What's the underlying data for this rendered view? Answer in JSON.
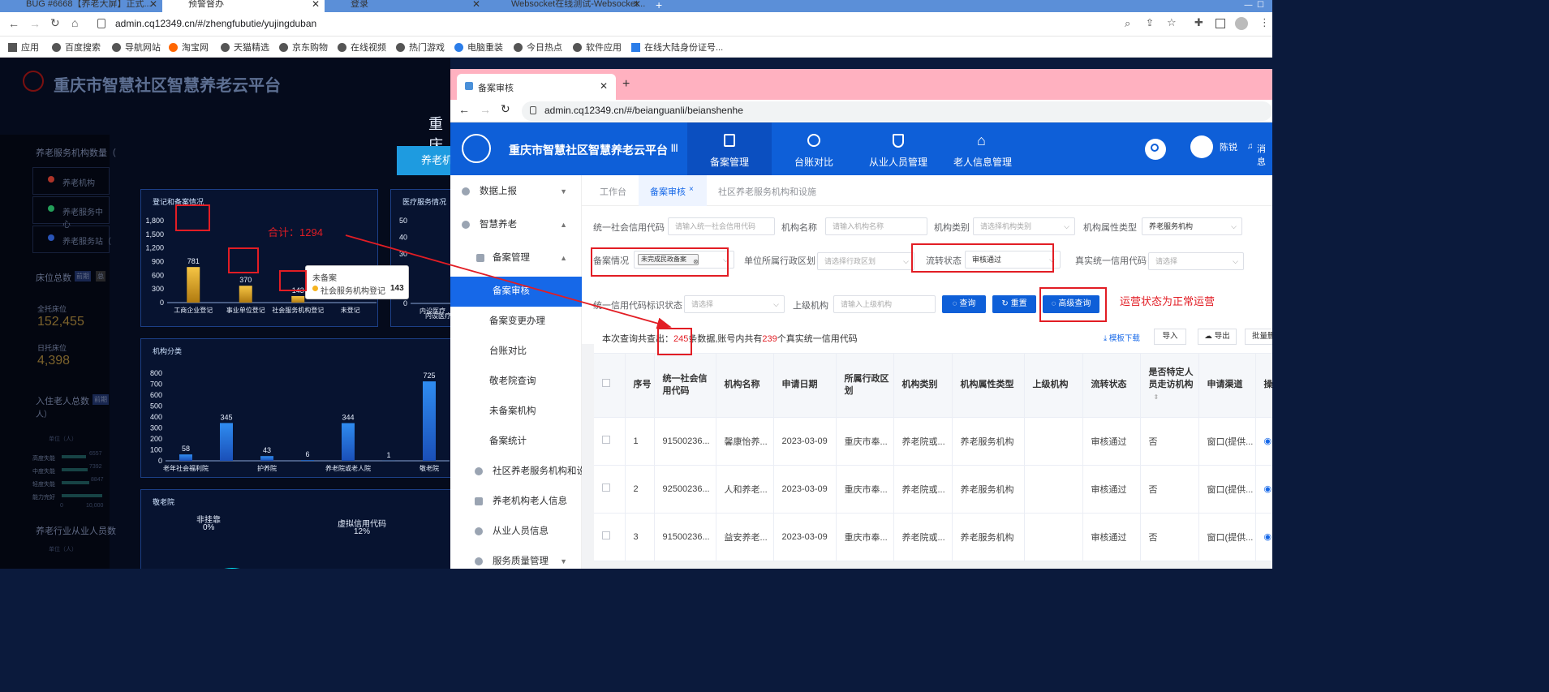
{
  "browser": {
    "tabs": [
      "BUG #6668【养老大屏】正式...",
      "预警督办",
      "登录",
      "Websocket在线测试-Websocket..."
    ],
    "url": "admin.cq12349.cn/#/zhengfubutie/yujingduban",
    "new_tab": "+",
    "bookmarks": [
      "应用",
      "百度搜索",
      "导航网站",
      "淘宝网",
      "天猫精选",
      "京东购物",
      "在线视频",
      "热门游戏",
      "电脑重装",
      "今日热点",
      "软件应用",
      "在线大陆身份证号..."
    ]
  },
  "dashboard": {
    "title": "重庆市智慧社区智慧养老云平台",
    "center_title": "重庆",
    "center_button": "养老机",
    "left_stats": {
      "heading": "养老服务机构数量（",
      "items": [
        "养老机构",
        "养老服务中心",
        "养老服务站（"
      ],
      "bed_heading": "床位总数",
      "bed_tags": [
        "前期",
        "总"
      ],
      "total_beds_label": "全托床位",
      "total_beds": "152,455",
      "daycare_label": "日托床位",
      "daycare_beds": "4,398",
      "residents_heading": "入住老人总数",
      "residents_tag": "前期",
      "residents_unit": "人）",
      "unit_label": "单位（人）",
      "care_levels": [
        "高度失能",
        "中度失能",
        "轻度失能",
        "能力完好"
      ],
      "care_values": [
        "6557",
        "7392",
        "8847",
        ""
      ],
      "axis": [
        "0",
        "10,000"
      ],
      "staff_heading": "养老行业从业人员数",
      "staff_unit": "单位（人）"
    },
    "chart1": {
      "title": "登记和备案情况",
      "annotation": "合计：1294",
      "tooltip_title": "未备案",
      "tooltip_label": "社会服务机构登记",
      "tooltip_value": "143"
    },
    "chart2_title": "医疗服务情况",
    "chart2_note": "内设医疗",
    "chart3_title": "机构分类",
    "chart4": {
      "title": "敬老院",
      "labels": [
        "非挂靠",
        "虚拟信用代码"
      ],
      "values": [
        "0%",
        "12%"
      ]
    }
  },
  "chart_data": [
    {
      "type": "bar",
      "title": "登记和备案情况",
      "categories": [
        "工商企业登记",
        "事业单位登记",
        "社会服务机构登记",
        "未登记"
      ],
      "values": [
        781,
        370,
        143,
        0
      ],
      "ylim": [
        0,
        1800
      ],
      "yticks": [
        "0",
        "300",
        "600",
        "900",
        "1,200",
        "1,500",
        "1,800"
      ]
    },
    {
      "type": "bar",
      "title": "医疗服务情况",
      "ylim": [
        0,
        50
      ],
      "yticks": [
        "0",
        "10",
        "30",
        "40",
        "50"
      ],
      "categories": [
        "内设医疗"
      ]
    },
    {
      "type": "bar",
      "title": "机构分类",
      "categories": [
        "老年社会福利院",
        "",
        "护养院",
        "",
        "养老院或老人院",
        "",
        "敬老院"
      ],
      "values": [
        58,
        345,
        43,
        6,
        344,
        1,
        725
      ],
      "ylim": [
        0,
        800
      ],
      "yticks": [
        "0",
        "100",
        "200",
        "300",
        "400",
        "500",
        "600",
        "700",
        "800"
      ]
    },
    {
      "type": "pie",
      "title": "敬老院",
      "labels": [
        "非挂靠",
        "虚拟信用代码"
      ],
      "values": [
        0,
        12
      ]
    }
  ],
  "inner": {
    "tab_title": "备案审核",
    "url": "admin.cq12349.cn/#/beianguanli/beianshenhe",
    "app_title": "重庆市智慧社区智慧养老云平台",
    "nav": [
      "备案管理",
      "台账对比",
      "从业人员管理",
      "老人信息管理"
    ],
    "user": "陈锐",
    "msg": "消息",
    "sidebar": [
      "数据上报",
      "智慧养老",
      "备案管理",
      "备案审核",
      "备案变更办理",
      "台账对比",
      "敬老院查询",
      "未备案机构",
      "备案统计",
      "社区养老服务机构和设施",
      "养老机构老人信息",
      "从业人员信息",
      "服务质量管理"
    ],
    "page_tabs": [
      "工作台",
      "备案审核",
      "社区养老服务机构和设施"
    ],
    "form": {
      "credit_label": "统一社会信用代码",
      "credit_ph": "请输入统一社会信用代码",
      "name_label": "机构名称",
      "name_ph": "请输入机构名称",
      "type_label": "机构类别",
      "type_ph": "请选择机构类别",
      "attr_label": "机构属性类型",
      "attr_val": "养老服务机构",
      "record_label": "备案情况",
      "record_val": "未完成民政备案",
      "region_label": "单位所属行政区划",
      "region_ph": "请选择行政区划",
      "flow_label": "流转状态",
      "flow_val": "审核通过",
      "real_label": "真实统一信用代码",
      "real_ph": "请选择",
      "code_label": "统一信用代码标识状态",
      "code_ph": "请选择",
      "parent_label": "上级机构",
      "parent_ph": "请输入上级机构",
      "query": "查询",
      "reset": "重置",
      "adv": "高级查询"
    },
    "note": "运营状态为正常运营",
    "summary": {
      "prefix": "本次查询共查出：",
      "count": "245",
      "mid": "条数据,账号内共有",
      "real": "239",
      "suffix": "个真实统一信用代码"
    },
    "actions": [
      "模板下载",
      "导入",
      "导出",
      "批量删"
    ],
    "columns": [
      "序号",
      "统一社会信用代码",
      "机构名称",
      "申请日期",
      "所属行政区划",
      "机构类别",
      "机构属性类型",
      "上级机构",
      "流转状态",
      "是否特定人员走访机构",
      "申请渠道",
      "操"
    ],
    "rows": [
      [
        "1",
        "91500236...",
        "馨康怡养...",
        "2023-03-09",
        "重庆市奉...",
        "养老院或...",
        "养老服务机构",
        "",
        "审核通过",
        "否",
        "窗口(提供..."
      ],
      [
        "2",
        "92500236...",
        "人和养老...",
        "2023-03-09",
        "重庆市奉...",
        "养老院或...",
        "养老服务机构",
        "",
        "审核通过",
        "否",
        "窗口(提供..."
      ],
      [
        "3",
        "91500236...",
        "益安养老...",
        "2023-03-09",
        "重庆市奉...",
        "养老院或...",
        "养老服务机构",
        "",
        "审核通过",
        "否",
        "窗口(提供..."
      ]
    ]
  }
}
